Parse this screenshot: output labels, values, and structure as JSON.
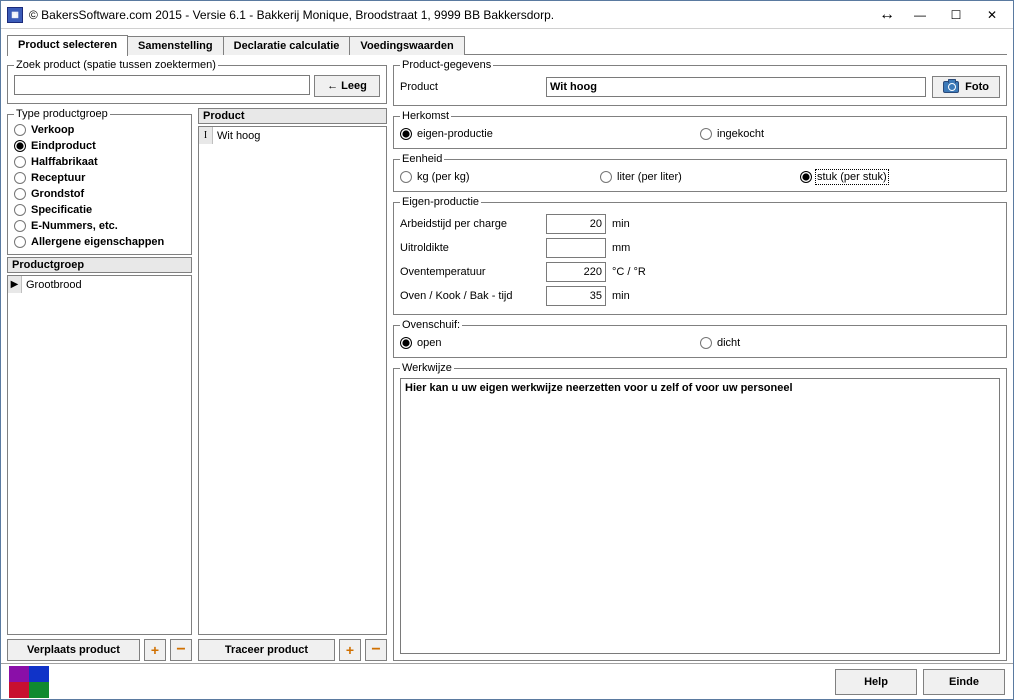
{
  "window": {
    "title": "© BakersSoftware.com 2015 - Versie 6.1 - Bakkerij Monique, Broodstraat 1, 9999 BB Bakkersdorp."
  },
  "tabs": {
    "t0": "Product selecteren",
    "t1": "Samenstelling",
    "t2": "Declaratie calculatie",
    "t3": "Voedingswaarden"
  },
  "search": {
    "legend": "Zoek product (spatie tussen zoektermen)",
    "value": "",
    "empty_btn": "← Leeg"
  },
  "typegroup": {
    "legend": "Type productgroep",
    "o0": "Verkoop",
    "o1": "Eindproduct",
    "o2": "Halffabrikaat",
    "o3": "Receptuur",
    "o4": "Grondstof",
    "o5": "Specificatie",
    "o6": "E-Nummers, etc.",
    "o7": "Allergene eigenschappen"
  },
  "productgroup": {
    "header": "Productgroep",
    "item0": "Grootbrood"
  },
  "productlist": {
    "header": "Product",
    "item0": "Wit hoog"
  },
  "left_buttons": {
    "move": "Verplaats product",
    "trace": "Traceer product"
  },
  "details": {
    "legend": "Product-gegevens",
    "product_label": "Product",
    "product_value": "Wit hoog",
    "foto_btn": "Foto"
  },
  "herkomst": {
    "legend": "Herkomst",
    "own": "eigen-productie",
    "bought": "ingekocht"
  },
  "eenheid": {
    "legend": "Eenheid",
    "kg": "kg (per kg)",
    "liter": "liter (per liter)",
    "stuk": "stuk (per stuk)"
  },
  "eigenprod": {
    "legend": "Eigen-productie",
    "charge_label": "Arbeidstijd per charge",
    "charge_value": "20",
    "charge_unit": "min",
    "uitrol_label": "Uitroldikte",
    "uitrol_value": "",
    "uitrol_unit": "mm",
    "oventemp_label": "Oventemperatuur",
    "oventemp_value": "220",
    "oventemp_unit": "°C / °R",
    "oventime_label": "Oven / Kook / Bak - tijd",
    "oventime_value": "35",
    "oventime_unit": "min"
  },
  "ovenschuif": {
    "legend": "Ovenschuif:",
    "open": "open",
    "dicht": "dicht"
  },
  "werkwijze": {
    "legend": "Werkwijze",
    "text": "Hier kan u uw eigen werkwijze neerzetten voor u zelf of voor uw personeel"
  },
  "footer": {
    "help": "Help",
    "einde": "Einde"
  }
}
